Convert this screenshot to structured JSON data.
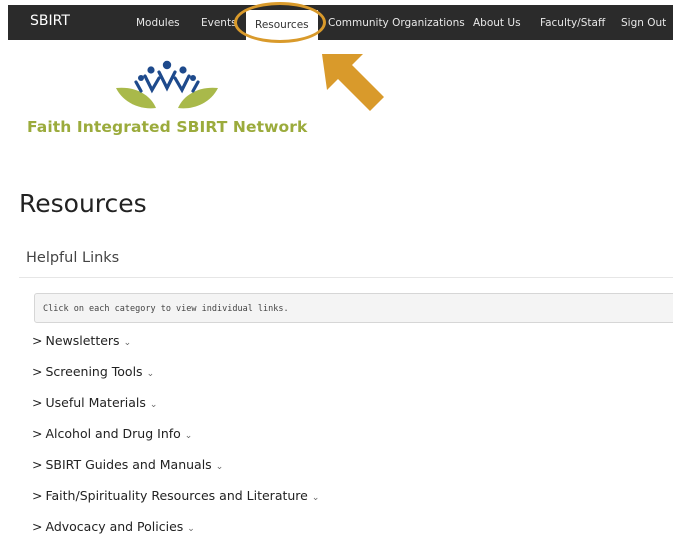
{
  "nav": {
    "brand": "SBIRT",
    "items": [
      {
        "label": "Modules"
      },
      {
        "label": "Events"
      },
      {
        "label": "Resources"
      },
      {
        "label": "Community Organizations"
      },
      {
        "label": "About Us"
      },
      {
        "label": "Faculty/Staff"
      },
      {
        "label": "Sign Out"
      }
    ],
    "active_item": "Resources"
  },
  "annotation": {
    "highlight_color": "#d99a2b",
    "pointer_icon": "arrow-icon"
  },
  "logo": {
    "text": "Faith Integrated SBIRT Network",
    "text_color": "#9bab3c",
    "figure_color": "#1e4a8c"
  },
  "page": {
    "title": "Resources",
    "section_heading": "Helpful Links",
    "instruction": "Click on each category to view individual links."
  },
  "categories": [
    {
      "label": "Newsletters"
    },
    {
      "label": "Screening Tools"
    },
    {
      "label": "Useful Materials"
    },
    {
      "label": "Alcohol and Drug Info"
    },
    {
      "label": "SBIRT Guides and Manuals"
    },
    {
      "label": "Faith/Spirituality Resources and Literature"
    },
    {
      "label": "Advocacy and Policies"
    }
  ],
  "icons": {
    "chevron": ">",
    "caret": "⌄"
  }
}
